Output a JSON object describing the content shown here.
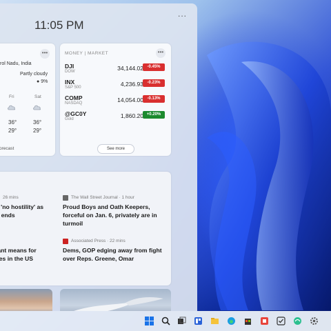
{
  "clock": "11:05 PM",
  "panel_menu": "...",
  "weather": {
    "location": "rol Nadu, India",
    "condition": "Partly cloudy",
    "precip": "9%",
    "days": [
      {
        "day": "Fri",
        "high": "36°",
        "low": "29°"
      },
      {
        "day": "Sat",
        "high": "36°",
        "low": "29°"
      }
    ],
    "footer": "orecast"
  },
  "market": {
    "title": "MONEY | MARKET",
    "rows": [
      {
        "symbol": "DJI",
        "name": "DOW",
        "value": "34,144.02",
        "change": "-0.45%",
        "direction": "down"
      },
      {
        "symbol": "INX",
        "name": "S&P 500",
        "value": "4,236.93",
        "change": "-0.23%",
        "direction": "down"
      },
      {
        "symbol": "COMP",
        "name": "NASDAQ",
        "value": "14,054.00",
        "change": "-0.13%",
        "direction": "down"
      },
      {
        "symbol": "@GC0Y",
        "name": "Gold",
        "value": "1,860.20",
        "change": "+0.20%",
        "direction": "up"
      }
    ],
    "see_more": "See more",
    "colors": {
      "down": "#d92f2f",
      "up": "#1c8a2e"
    }
  },
  "news": {
    "left": {
      "time1": "26 mins",
      "headline1": [
        "s 'no hostility' as",
        "n ends"
      ],
      "headline2": [
        "iant means for",
        "ses in the US"
      ]
    },
    "right": {
      "source1": "The Wall Street Journal · 1 hour",
      "headline1": [
        "Proud Boys and Oath Keepers,",
        "forceful on Jan. 6, privately are in",
        "turmoil"
      ],
      "source2": "Associated Press · 22 mins",
      "headline2": [
        "Dems, GOP edging away from fight",
        "over Reps. Greene, Omar"
      ]
    }
  },
  "taskbar_icons": [
    "windows-start-icon",
    "search-icon",
    "task-view-icon",
    "widgets-icon",
    "file-explorer-icon",
    "edge-icon",
    "store-icon",
    "app-icon",
    "todo-icon",
    "network-app-icon",
    "settings-icon"
  ]
}
